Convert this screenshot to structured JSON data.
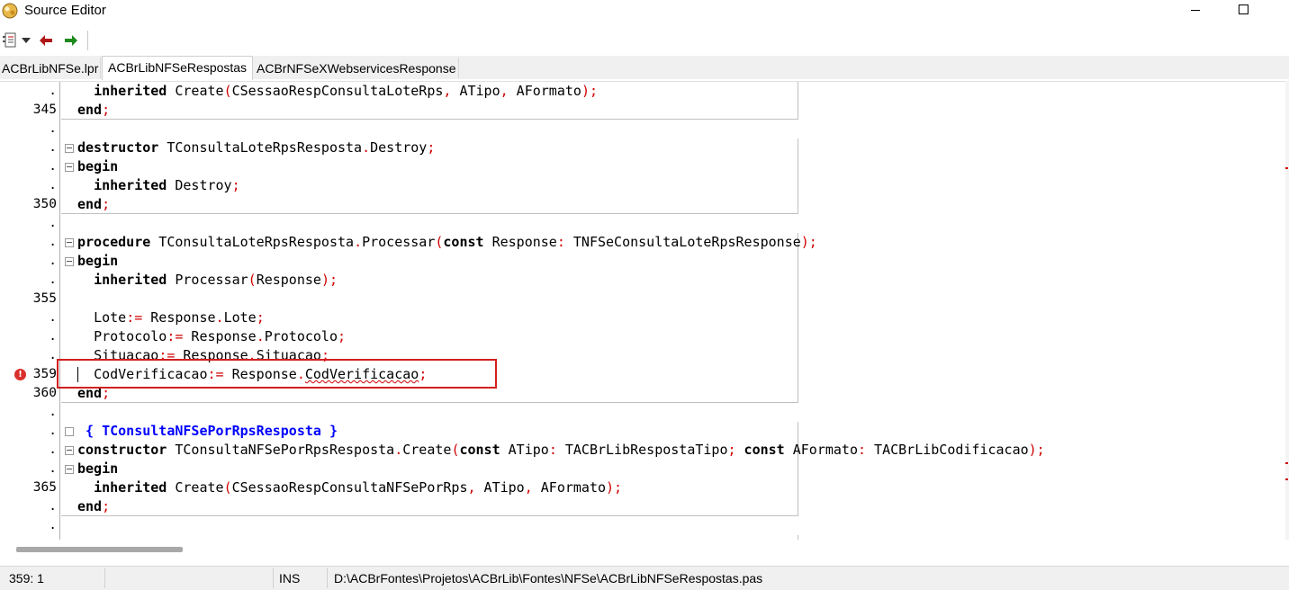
{
  "window": {
    "title": "Source Editor"
  },
  "tabs": [
    {
      "label": "ACBrLibNFSe.lpr",
      "active": false
    },
    {
      "label": "ACBrLibNFSeRespostas",
      "active": true
    },
    {
      "label": "ACBrNFSeXWebservicesResponse",
      "active": false
    }
  ],
  "gutter": {
    "numbers": [
      "345",
      "350",
      "355",
      "359",
      "360",
      "365"
    ],
    "dot": "."
  },
  "error_marker": "!",
  "code": {
    "l1_kw": "inherited",
    "l1_rest": " Create",
    "l1_p1": "(",
    "l1_args": "CSessaoRespConsultaLoteRps",
    "l1_c1": ",",
    "l1_a2": " ATipo",
    "l1_c2": ",",
    "l1_a3": " AFormato",
    "l1_end": ");",
    "l2_kw": "end",
    "l2_sym": ";",
    "l3_kw": "destructor",
    "l3_rest": " TConsultaLoteRpsResposta",
    "l3_dot": ".",
    "l3_name": "Destroy",
    "l3_sym": ";",
    "l4_kw": "begin",
    "l5_kw": "inherited",
    "l5_rest": " Destroy",
    "l5_sym": ";",
    "l6_kw": "end",
    "l6_sym": ";",
    "l7_kw": "procedure",
    "l7_rest": " TConsultaLoteRpsResposta",
    "l7_dot": ".",
    "l7_name": "Processar",
    "l7_p": "(",
    "l7_kw2": "const",
    "l7_arg": " Response",
    "l7_colon": ":",
    "l7_type": " TNFSeConsultaLoteRpsResponse",
    "l7_end": ");",
    "l8_kw": "begin",
    "l9_kw": "inherited",
    "l9_rest": " Processar",
    "l9_p": "(",
    "l9_arg": "Response",
    "l9_end": ");",
    "l10_a": "Lote",
    "l10_op": ":=",
    "l10_b": " Response",
    "l10_dot": ".",
    "l10_c": "Lote",
    "l10_sym": ";",
    "l11_a": "Protocolo",
    "l11_op": ":=",
    "l11_b": " Response",
    "l11_dot": ".",
    "l11_c": "Protocolo",
    "l11_sym": ";",
    "l12_a": "Situacao",
    "l12_op": ":=",
    "l12_b": " Response",
    "l12_dot": ".",
    "l12_c": "Situacao",
    "l12_sym": ";",
    "l13_a": "CodVerificacao",
    "l13_op": ":=",
    "l13_b": " Response",
    "l13_dot": ".",
    "l13_c": "CodVerificacao",
    "l13_sym": ";",
    "l14_kw": "end",
    "l14_sym": ";",
    "l15_comment": "{ TConsultaNFSePorRpsResposta }",
    "l16_kw": "constructor",
    "l16_rest": " TConsultaNFSePorRpsResposta",
    "l16_dot": ".",
    "l16_name": "Create",
    "l16_p": "(",
    "l16_kw2": "const",
    "l16_a1": " ATipo",
    "l16_colon1": ":",
    "l16_t1": " TACBrLibRespostaTipo",
    "l16_semi": ";",
    "l16_kw3": " const",
    "l16_a2": " AFormato",
    "l16_colon2": ":",
    "l16_t2": " TACBrLibCodificacao",
    "l16_end": ");",
    "l17_kw": "begin",
    "l18_kw": "inherited",
    "l18_rest": " Create",
    "l18_p": "(",
    "l18_args": "CSessaoRespConsultaNFSePorRps",
    "l18_c1": ",",
    "l18_a2": " ATipo",
    "l18_c2": ",",
    "l18_a3": " AFormato",
    "l18_end": ");",
    "l19_kw": "end",
    "l19_sym": ";"
  },
  "status": {
    "position": "359:  1",
    "mode": "INS",
    "path": "D:\\ACBrFontes\\Projetos\\ACBrLib\\Fontes\\NFSe\\ACBrLibNFSeRespostas.pas"
  },
  "colors": {
    "keyword": "#000000",
    "symbol": "#d00000",
    "comment": "#0000ff",
    "highlight": "#d21f1f"
  }
}
